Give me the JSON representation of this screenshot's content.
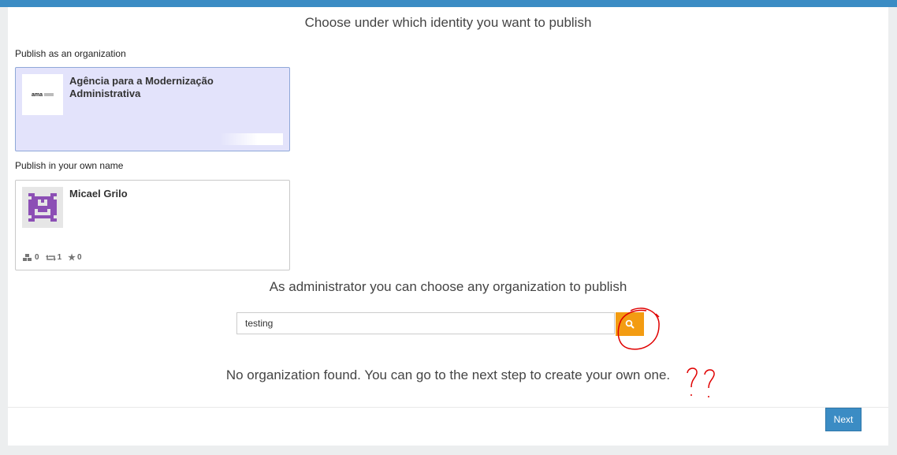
{
  "header": {
    "title": "Choose under which identity you want to publish"
  },
  "organization_section": {
    "label": "Publish as an organization",
    "card": {
      "name": "Agência para a Modernização Administrativa",
      "logo_text": "ama"
    }
  },
  "own_name_section": {
    "label": "Publish in your own name",
    "card": {
      "name": "Micael Grilo",
      "stats": {
        "datasets": "0",
        "reuses": "1",
        "stars": "0"
      }
    }
  },
  "admin": {
    "text": "As administrator you can choose any organization to publish"
  },
  "search": {
    "value": "testing",
    "icon": "search-icon"
  },
  "result": {
    "text": "No organization found. You can go to the next step to create your own one."
  },
  "footer": {
    "next_label": "Next"
  },
  "colors": {
    "accent": "#3b8cc4",
    "search_button": "#f39c12",
    "selected_card": "#e3e3fb",
    "annotation": "#e00000"
  }
}
